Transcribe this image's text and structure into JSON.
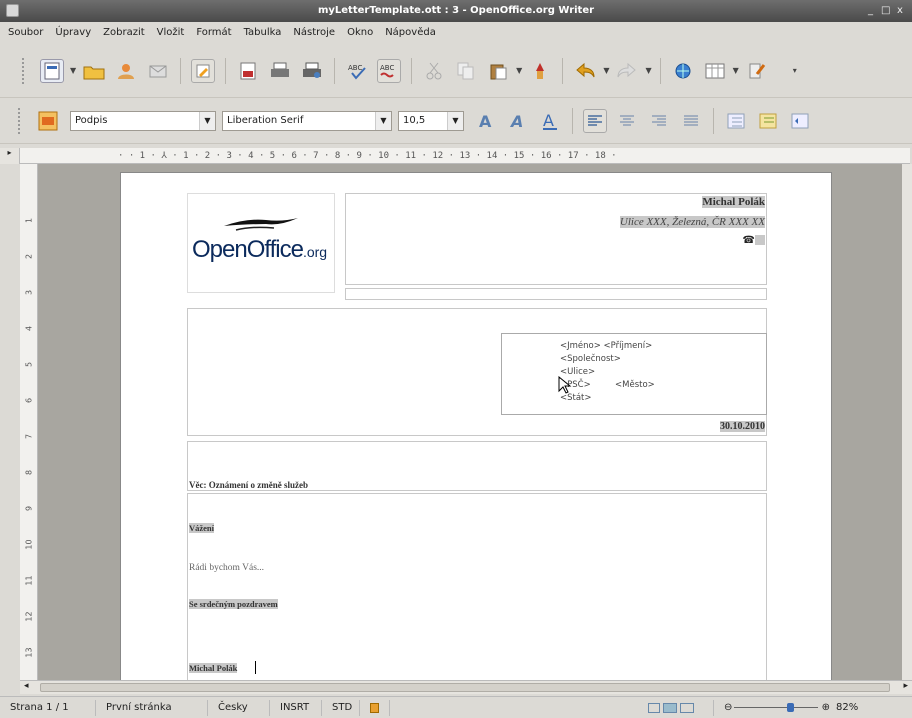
{
  "window": {
    "title": "myLetterTemplate.ott : 3 - OpenOffice.org Writer",
    "controls": [
      "_",
      "□",
      "x"
    ]
  },
  "menu": [
    "Soubor",
    "Úpravy",
    "Zobrazit",
    "Vložit",
    "Formát",
    "Tabulka",
    "Nástroje",
    "Okno",
    "Nápověda"
  ],
  "formatting": {
    "style": "Podpis",
    "font": "Liberation Serif",
    "size": "10,5"
  },
  "ruler": {
    "h_ticks": "· · 1 · ⅄ · 1 · 2 · 3 · 4 · 5 · 6 · 7 · 8 · 9 · 10 · 11 · 12 · 13 · 14 · 15 · 16 · 17 · 18 ·",
    "v_ticks": [
      "1",
      "2",
      "3",
      "4",
      "5",
      "6",
      "7",
      "8",
      "9",
      "10",
      "11",
      "12",
      "13"
    ]
  },
  "document": {
    "logo_text": "OpenOffice",
    "logo_suffix": ".org",
    "sender_name": "Michal Polák",
    "sender_address": "Ulice XXX, Železná, ČR XXX XX",
    "address_lines": [
      "<Jméno> <Příjmení>",
      "<Společnost>",
      "<Ulice>",
      "<PSČ>         <Město>",
      "<Stát>"
    ],
    "date": "30.10.2010",
    "subject": "Věc: Oznámení o změně služeb",
    "greeting": "Vážení",
    "body": "Rádi bychom Vás...",
    "closing": "Se srdečným pozdravem",
    "signature": "Michal Polák"
  },
  "status": {
    "page": "Strana 1 / 1",
    "page_style": "První stránka",
    "language": "Česky",
    "insert_mode": "INSRT",
    "selection_mode": "STD",
    "zoom": "82%",
    "zoom_fraction": 0.82
  },
  "colors": {
    "titlebar": "#555555",
    "background": "#dcdad5",
    "field_shade": "#c8c8c8"
  }
}
